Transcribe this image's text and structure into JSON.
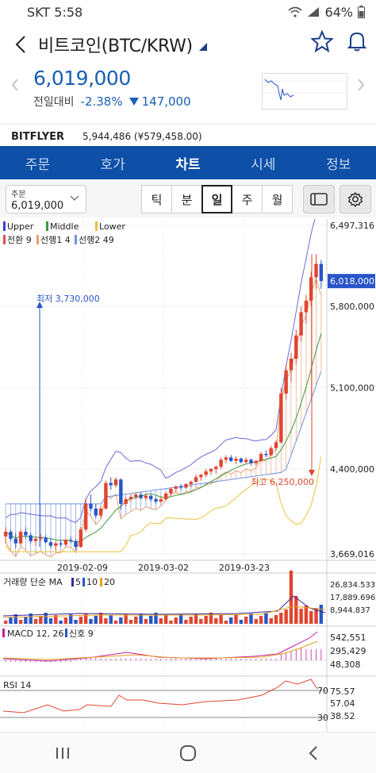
{
  "status_bar": {
    "carrier": "SKT",
    "time": "5:58",
    "battery": "64%"
  },
  "header": {
    "title": "비트코인(BTC/KRW)"
  },
  "price": {
    "current": "6,019,000",
    "change_label": "전일대비",
    "change_pct": "-2.38%",
    "change_amount": "147,000"
  },
  "exchange": {
    "name": "BITFLYER",
    "value": "5,944,486 (¥579,458.00)"
  },
  "tabs": [
    {
      "label": "주문",
      "active": false
    },
    {
      "label": "호가",
      "active": false
    },
    {
      "label": "차트",
      "active": true
    },
    {
      "label": "시세",
      "active": false
    },
    {
      "label": "정보",
      "active": false
    }
  ],
  "order_select": {
    "label": "주문",
    "value": "6,019,000"
  },
  "periods": [
    {
      "label": "틱",
      "active": false
    },
    {
      "label": "분",
      "active": false
    },
    {
      "label": "일",
      "active": true
    },
    {
      "label": "주",
      "active": false
    },
    {
      "label": "월",
      "active": false
    }
  ],
  "colors": {
    "up": "#e0452f",
    "down": "#2855c9",
    "accent": "#0e4fa8",
    "upper": "#6a6ad8",
    "middle": "#3a9a3a",
    "lower": "#e8c23a",
    "span1": "#e8a070",
    "span2": "#7090e0"
  },
  "legend": {
    "bb": [
      {
        "name": "Upper",
        "color": "#3e3ed0"
      },
      {
        "name": "Middle",
        "color": "#3a9a3a"
      },
      {
        "name": "Lower",
        "color": "#e8c23a"
      }
    ],
    "ichimoku": [
      {
        "name": "전환 9",
        "color": "#e05050"
      },
      {
        "name": "선행1 4",
        "color": "#e8a070"
      },
      {
        "name": "선행2 49",
        "color": "#7090e0"
      }
    ]
  },
  "chart_data": {
    "type": "candlestick",
    "main_axis": {
      "ticks": [
        "6,497,316",
        "5,800,000",
        "5,100,000",
        "4,400,000",
        "3,669,016"
      ],
      "tick_values": [
        6497316,
        5800000,
        5100000,
        4400000,
        3669016
      ],
      "ylim": [
        3669016,
        6497316
      ],
      "current_label": "6,018,000",
      "current_value": 6018000
    },
    "annotations": [
      {
        "text": "최저 3,730,000",
        "value": 3730000
      },
      {
        "text": "최고 6,250,000",
        "value": 6250000
      }
    ],
    "x_dates": [
      "2019-02-09",
      "2019-03-02",
      "2019-03-23"
    ],
    "volume": {
      "title": "거래량 단순 MA",
      "ma_labels": [
        {
          "text": "5",
          "color": "#3a2a9a"
        },
        {
          "text": "10",
          "color": "#2855c9"
        },
        {
          "text": "20",
          "color": "#e8a020"
        }
      ],
      "ticks": [
        "26,834.533",
        "17,889.696",
        "8,944.837"
      ]
    },
    "macd": {
      "title": "MACD 12, 26",
      "signal_label": "신호 9",
      "ticks": [
        "542,551",
        "295,429",
        "48,308"
      ]
    },
    "rsi": {
      "title": "RSI 14",
      "levels": [
        "70",
        "30"
      ],
      "ticks": [
        "75.57",
        "57.04",
        "38.52"
      ]
    },
    "candles": [
      [
        3820000,
        3900000,
        3760000,
        3860000
      ],
      [
        3860000,
        3880000,
        3780000,
        3800000
      ],
      [
        3800000,
        3850000,
        3720000,
        3760000
      ],
      [
        3760000,
        3880000,
        3740000,
        3860000
      ],
      [
        3860000,
        3900000,
        3800000,
        3830000
      ],
      [
        3830000,
        3850000,
        3760000,
        3780000
      ],
      [
        3780000,
        3820000,
        3740000,
        3800000
      ],
      [
        3800000,
        3840000,
        3780000,
        3810000
      ],
      [
        3810000,
        3830000,
        3760000,
        3770000
      ],
      [
        3770000,
        3800000,
        3720000,
        3740000
      ],
      [
        3740000,
        3780000,
        3700000,
        3760000
      ],
      [
        3760000,
        3790000,
        3730000,
        3750000
      ],
      [
        3750000,
        3800000,
        3730000,
        3790000
      ],
      [
        3790000,
        3820000,
        3760000,
        3780000
      ],
      [
        3780000,
        3800000,
        3700000,
        3730000
      ],
      [
        3730000,
        3900000,
        3720000,
        3880000
      ],
      [
        3880000,
        4150000,
        3860000,
        4100000
      ],
      [
        4100000,
        4180000,
        4040000,
        4060000
      ],
      [
        4060000,
        4100000,
        3980000,
        4000000
      ],
      [
        4000000,
        4080000,
        3980000,
        4060000
      ],
      [
        4060000,
        4300000,
        4050000,
        4280000
      ],
      [
        4280000,
        4330000,
        4220000,
        4260000
      ],
      [
        4260000,
        4330000,
        4240000,
        4310000
      ],
      [
        4310000,
        4320000,
        4050000,
        4100000
      ],
      [
        4100000,
        4160000,
        4080000,
        4140000
      ],
      [
        4140000,
        4180000,
        4120000,
        4160000
      ],
      [
        4160000,
        4200000,
        4140000,
        4180000
      ],
      [
        4180000,
        4200000,
        4140000,
        4150000
      ],
      [
        4150000,
        4190000,
        4130000,
        4170000
      ],
      [
        4170000,
        4180000,
        4120000,
        4140000
      ],
      [
        4140000,
        4160000,
        4100000,
        4120000
      ],
      [
        4120000,
        4160000,
        4110000,
        4140000
      ],
      [
        4140000,
        4200000,
        4130000,
        4190000
      ],
      [
        4190000,
        4240000,
        4170000,
        4230000
      ],
      [
        4230000,
        4260000,
        4200000,
        4250000
      ],
      [
        4250000,
        4270000,
        4220000,
        4240000
      ],
      [
        4240000,
        4280000,
        4230000,
        4270000
      ],
      [
        4270000,
        4300000,
        4240000,
        4290000
      ],
      [
        4290000,
        4350000,
        4280000,
        4330000
      ],
      [
        4330000,
        4360000,
        4300000,
        4350000
      ],
      [
        4350000,
        4400000,
        4330000,
        4380000
      ],
      [
        4380000,
        4410000,
        4350000,
        4400000
      ],
      [
        4400000,
        4430000,
        4360000,
        4420000
      ],
      [
        4420000,
        4500000,
        4400000,
        4480000
      ],
      [
        4480000,
        4520000,
        4450000,
        4500000
      ],
      [
        4500000,
        4520000,
        4460000,
        4470000
      ],
      [
        4470000,
        4510000,
        4440000,
        4490000
      ],
      [
        4490000,
        4500000,
        4450000,
        4460000
      ],
      [
        4460000,
        4500000,
        4440000,
        4480000
      ],
      [
        4480000,
        4490000,
        4430000,
        4450000
      ],
      [
        4450000,
        4480000,
        4430000,
        4470000
      ],
      [
        4470000,
        4550000,
        4460000,
        4530000
      ],
      [
        4530000,
        4560000,
        4500000,
        4520000
      ],
      [
        4520000,
        4600000,
        4510000,
        4580000
      ],
      [
        4580000,
        4650000,
        4560000,
        4630000
      ],
      [
        4630000,
        5100000,
        4620000,
        5050000
      ],
      [
        5050000,
        5300000,
        5000000,
        5250000
      ],
      [
        5250000,
        5400000,
        5150000,
        5350000
      ],
      [
        5350000,
        5600000,
        5300000,
        5550000
      ],
      [
        5550000,
        5800000,
        5500000,
        5750000
      ],
      [
        5750000,
        5900000,
        5650000,
        5850000
      ],
      [
        5850000,
        6100000,
        5800000,
        6050000
      ],
      [
        6050000,
        6250000,
        5950000,
        6166000
      ],
      [
        6166000,
        6200000,
        5950000,
        6018000
      ]
    ]
  }
}
